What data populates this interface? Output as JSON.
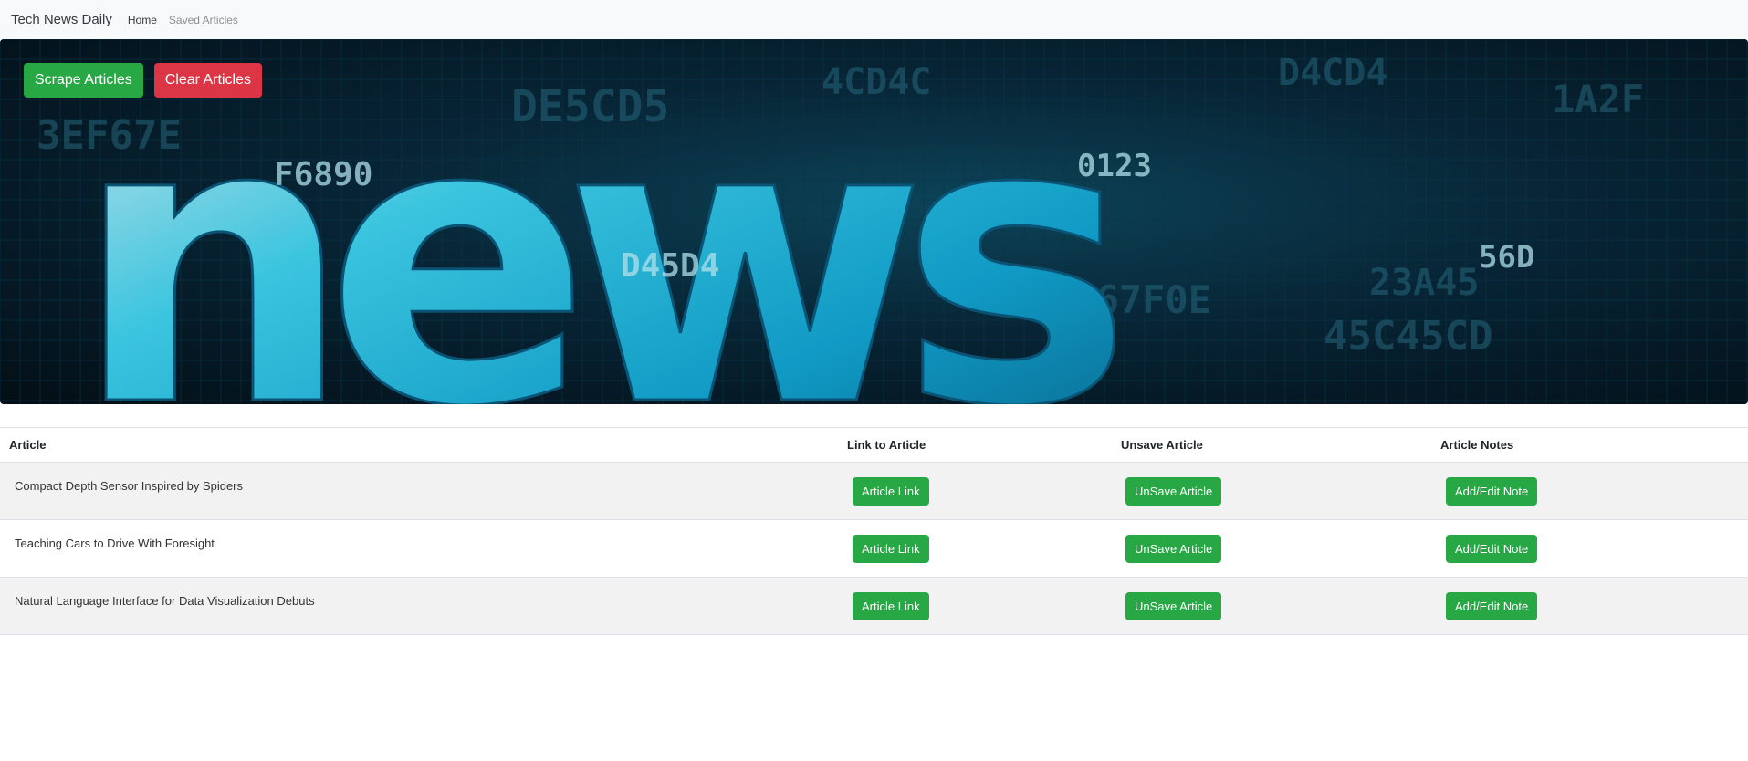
{
  "navbar": {
    "brand": "Tech News Daily",
    "links": [
      {
        "label": "Home",
        "active": true
      },
      {
        "label": "Saved Articles",
        "active": false
      }
    ]
  },
  "hero": {
    "background_word": "news",
    "scrape_label": "Scrape Articles",
    "clear_label": "Clear Articles"
  },
  "table": {
    "headers": {
      "article": "Article",
      "link": "Link to Article",
      "unsave": "Unsave Article",
      "notes": "Article Notes"
    },
    "rows": [
      {
        "title": "Compact Depth Sensor Inspired by Spiders",
        "link_label": "Article Link",
        "unsave_label": "UnSave Article",
        "note_label": "Add/Edit Note"
      },
      {
        "title": "Teaching Cars to Drive With Foresight",
        "link_label": "Article Link",
        "unsave_label": "UnSave Article",
        "note_label": "Add/Edit Note"
      },
      {
        "title": "Natural Language Interface for Data Visualization Debuts",
        "link_label": "Article Link",
        "unsave_label": "UnSave Article",
        "note_label": "Add/Edit Note"
      }
    ]
  },
  "colors": {
    "success": "#28a745",
    "danger": "#dc3545",
    "navbar_bg": "#f8f9fa",
    "stripe": "#f2f2f2"
  }
}
